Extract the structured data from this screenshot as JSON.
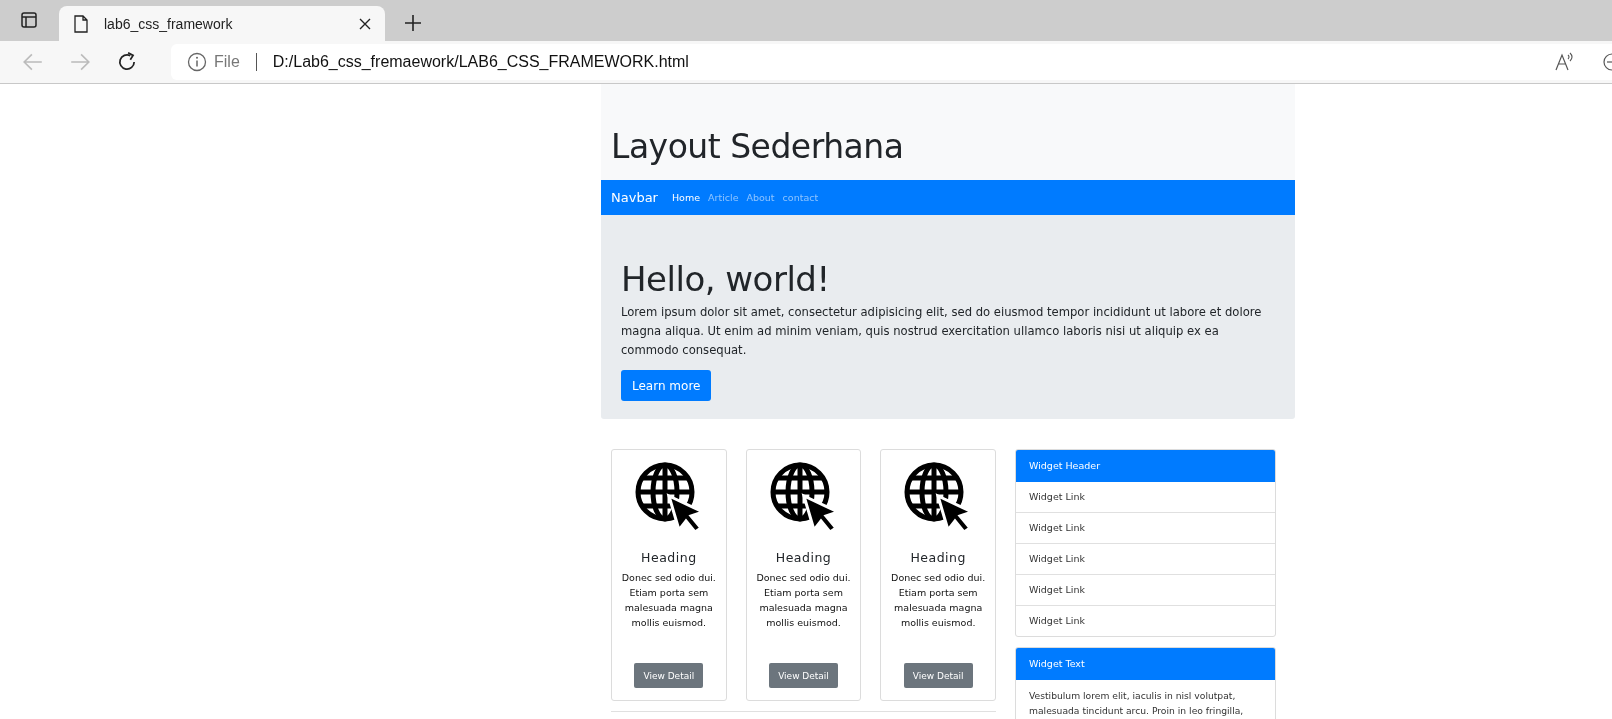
{
  "browser": {
    "tab_title": "lab6_css_framework",
    "url_scheme": "File",
    "url": "D:/Lab6_css_fremaework/LAB6_CSS_FRAMEWORK.html"
  },
  "header": {
    "title": "Layout Sederhana"
  },
  "navbar": {
    "brand": "Navbar",
    "items": [
      {
        "label": "Home",
        "selected": true
      },
      {
        "label": "Article",
        "selected": false
      },
      {
        "label": "About",
        "selected": false
      },
      {
        "label": "contact",
        "selected": false
      }
    ]
  },
  "jumbotron": {
    "title": "Hello, world!",
    "text": "Lorem ipsum dolor sit amet, consectetur adipisicing elit, sed do eiusmod tempor incididunt ut labore et dolore magna aliqua. Ut enim ad minim veniam, quis nostrud exercitation ullamco laboris nisi ut aliquip ex ea commodo consequat.",
    "button": "Learn more"
  },
  "cards": [
    {
      "heading": "Heading",
      "text": "Donec sed odio dui. Etiam porta sem malesuada magna mollis euismod.",
      "button": "View Detail"
    },
    {
      "heading": "Heading",
      "text": "Donec sed odio dui. Etiam porta sem malesuada magna mollis euismod.",
      "button": "View Detail"
    },
    {
      "heading": "Heading",
      "text": "Donec sed odio dui. Etiam porta sem malesuada magna mollis euismod.",
      "button": "View Detail"
    }
  ],
  "widgets": [
    {
      "kind": "links",
      "header": "Widget Header",
      "links": [
        "Widget Link",
        "Widget Link",
        "Widget Link",
        "Widget Link",
        "Widget Link"
      ]
    },
    {
      "kind": "text",
      "header": "Widget Text",
      "lines": [
        "Vestibulum lorem elit, iaculis in nisl volutpat,",
        "malesuada tincidunt arcu. Proin in leo fringilla,"
      ]
    }
  ]
}
